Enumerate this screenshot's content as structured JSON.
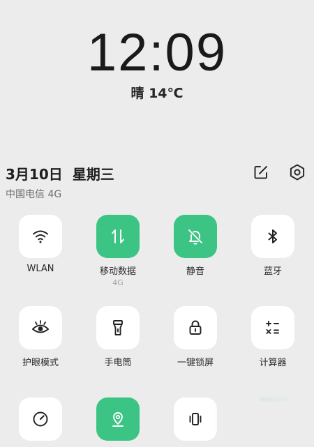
{
  "lockscreen": {
    "time": "12:09",
    "weather": "晴 14℃"
  },
  "header": {
    "date": "3月10日",
    "weekday": "星期三",
    "carrier": "中国电信 4G",
    "edit_icon": "edit-icon",
    "settings_icon": "settings-icon"
  },
  "tiles": [
    {
      "label": "WLAN",
      "icon": "wifi-icon",
      "active": false
    },
    {
      "label": "移动数据",
      "sub": "4G",
      "icon": "mobile-data-icon",
      "active": true
    },
    {
      "label": "静音",
      "icon": "bell-muted-icon",
      "active": true
    },
    {
      "label": "蓝牙",
      "icon": "bluetooth-icon",
      "active": false
    },
    {
      "label": "护眼模式",
      "icon": "eye-icon",
      "active": false
    },
    {
      "label": "手电筒",
      "icon": "flashlight-icon",
      "active": false
    },
    {
      "label": "一键锁屏",
      "icon": "lock-icon",
      "active": false
    },
    {
      "label": "计算器",
      "icon": "calculator-icon",
      "active": false
    },
    {
      "icon": "speedometer-icon",
      "active": false
    },
    {
      "icon": "location-icon",
      "active": true
    },
    {
      "icon": "vibrate-icon",
      "active": false
    }
  ],
  "colors": {
    "accent": "#3cc484",
    "background": "#ececec",
    "tile": "#ffffff"
  }
}
